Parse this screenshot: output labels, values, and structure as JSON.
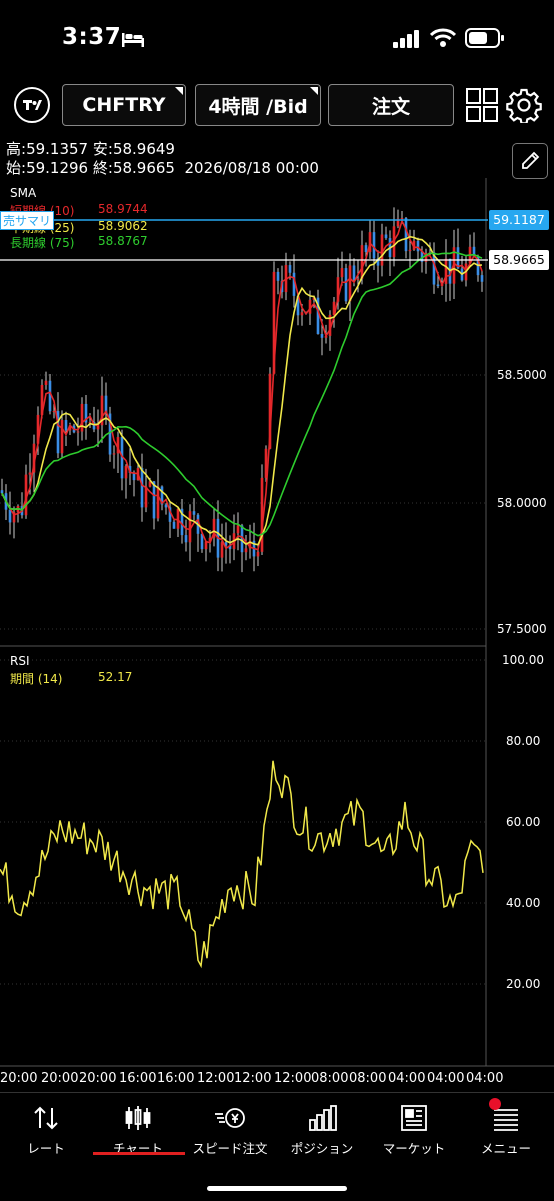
{
  "status_bar": {
    "time": "3:37"
  },
  "toolbar": {
    "symbol": "CHFTRY",
    "timeframe": "4時間 /Bid",
    "order": "注文"
  },
  "ohlc": {
    "high_label": "高:",
    "high": "59.1357",
    "low_label": "安:",
    "low": "58.9649",
    "open_label": "始:",
    "open": "59.1296",
    "close_label": "終:",
    "close": "58.9665",
    "datetime": "2026/08/18 00:00"
  },
  "sma_panel": {
    "title": "SMA",
    "short": {
      "label": "短期線 (10)",
      "value": "58.9744",
      "color": "#e5282b"
    },
    "mid": {
      "label": "中期線 (25)",
      "value": "58.9062",
      "color": "#f0e84a"
    },
    "long": {
      "label": "長期線 (75)",
      "value": "58.8767",
      "color": "#2ecc2e"
    },
    "sell_summary": "売サマリ",
    "price_axis": [
      "58.5000",
      "58.0000",
      "57.5000"
    ],
    "bid_line_price": "59.1187",
    "last_price": "58.9665",
    "colors": {
      "bid_line": "#27a7f0",
      "up_candle": "#e5282b",
      "down_candle": "#3a8ee6",
      "wick": "#cccccc"
    }
  },
  "rsi_panel": {
    "title": "RSI",
    "period_label": "期間 (14)",
    "value": "52.17",
    "axis": [
      "100.00",
      "80.00",
      "60.00",
      "40.00",
      "20.00"
    ]
  },
  "x_axis": [
    "20:00",
    "20:00",
    "20:00",
    "16:00",
    "16:00",
    "12:00",
    "12:00",
    "12:00",
    "08:00",
    "08:00",
    "04:00",
    "04:00",
    "04:00"
  ],
  "tabs": [
    {
      "label": "レート",
      "icon": "rate-arrows-icon"
    },
    {
      "label": "チャート",
      "icon": "candlestick-icon",
      "active": true
    },
    {
      "label": "スピード注文",
      "icon": "speed-order-icon"
    },
    {
      "label": "ポジション",
      "icon": "position-bars-icon"
    },
    {
      "label": "マーケット",
      "icon": "market-news-icon"
    },
    {
      "label": "メニュー",
      "icon": "menu-list-icon",
      "badge": true
    }
  ]
}
